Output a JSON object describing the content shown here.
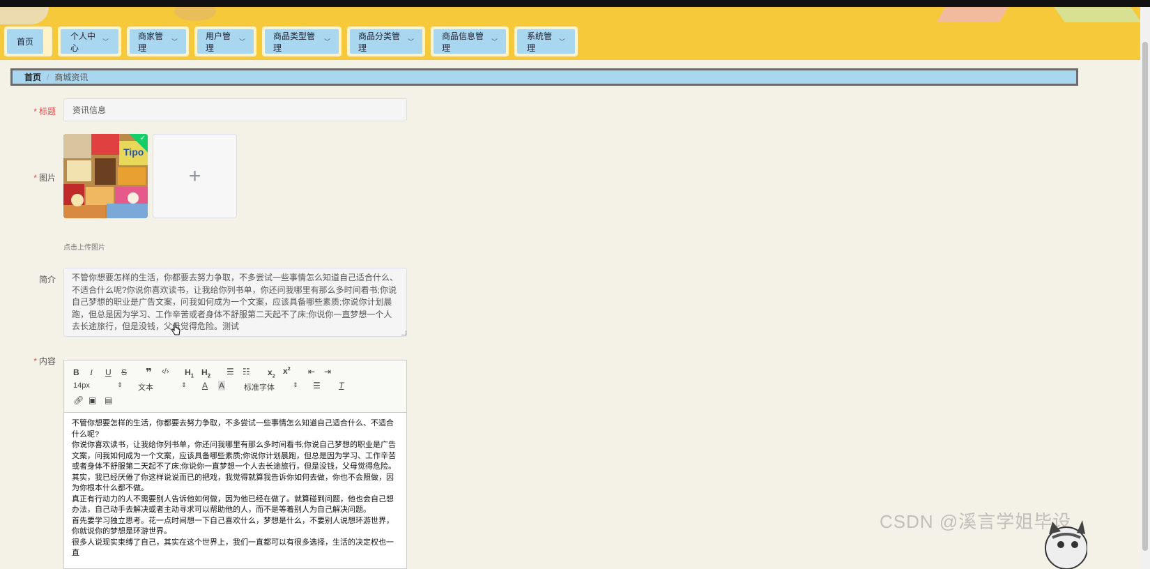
{
  "nav": {
    "items": [
      {
        "label": "首页",
        "has_dropdown": false
      },
      {
        "label": "个人中心",
        "has_dropdown": true
      },
      {
        "label": "商家管理",
        "has_dropdown": true
      },
      {
        "label": "用户管理",
        "has_dropdown": true
      },
      {
        "label": "商品类型管理",
        "has_dropdown": true
      },
      {
        "label": "商品分类管理",
        "has_dropdown": true
      },
      {
        "label": "商品信息管理",
        "has_dropdown": true
      },
      {
        "label": "系统管理",
        "has_dropdown": true
      }
    ]
  },
  "breadcrumb": {
    "home": "首页",
    "separator": "/",
    "current": "商城资讯"
  },
  "form": {
    "title_label": "标题",
    "title_value": "资讯信息",
    "image_label": "图片",
    "upload_tip": "点击上传图片",
    "upload_plus": "+",
    "intro_label": "简介",
    "intro_value": "不管你想要怎样的生活，你都要去努力争取，不多尝试一些事情怎么知道自己适合什么、不适合什么呢?你说你喜欢读书，让我给你列书单，你还问我哪里有那么多时间看书;你说自己梦想的职业是广告文案，问我如何成为一个文案，应该具备哪些素质;你说你计划晨跑，但总是因为学习、工作辛苦或者身体不舒服第二天起不了床;你说你一直梦想一个人去长途旅行，但是没钱，父母觉得危险。测试",
    "content_label": "内容"
  },
  "editor": {
    "font_size": "14px",
    "block_type": "文本",
    "font_family": "标准字体",
    "paragraphs": [
      "不管你想要怎样的生活，你都要去努力争取，不多尝试一些事情怎么知道自己适合什么、不适合什么呢?",
      "你说你喜欢读书，让我给你列书单，你还问我哪里有那么多时间看书;你说自己梦想的职业是广告文案，问我如何成为一个文案，应该具备哪些素质;你说你计划晨跑，但总是因为学习、工作辛苦或者身体不舒服第二天起不了床;你说你一直梦想一个人去长途旅行，但是没钱，父母觉得危险。其实，我已经厌倦了你这样说说而已的把戏，我觉得就算我告诉你如何去做，你也不会照做，因为你根本什么都不做。",
      "真正有行动力的人不需要别人告诉他如何做，因为他已经在做了。就算碰到问题，他也会自己想办法，自己动手去解决或者主动寻求可以帮助他的人，而不是等着别人为自己解决问题。",
      "首先要学习独立思考。花一点时间想一下自己喜欢什么，梦想是什么，不要别人说想环游世界，你就说你的梦想是环游世界。",
      "很多人说现实束缚了自己，其实在这个世界上，我们一直都可以有很多选择，生活的决定权也一直"
    ]
  },
  "watermark": "CSDN @溪言学姐毕设",
  "icons": [
    "chevron-down-icon",
    "plus-icon",
    "check-icon",
    "bold-icon",
    "italic-icon",
    "underline-icon",
    "strike-icon",
    "quote-icon",
    "code-icon",
    "h1-icon",
    "h2-icon",
    "ordered-list-icon",
    "bullet-list-icon",
    "subscript-icon",
    "superscript-icon",
    "outdent-icon",
    "indent-icon",
    "font-color-icon",
    "background-color-icon",
    "align-icon",
    "clear-format-icon",
    "link-icon",
    "image-icon",
    "video-icon"
  ],
  "colors": {
    "banner": "#f5c93a",
    "nav_button": "#a9d7f0",
    "required": "#e05050",
    "page_bg": "#f4f1e6"
  }
}
